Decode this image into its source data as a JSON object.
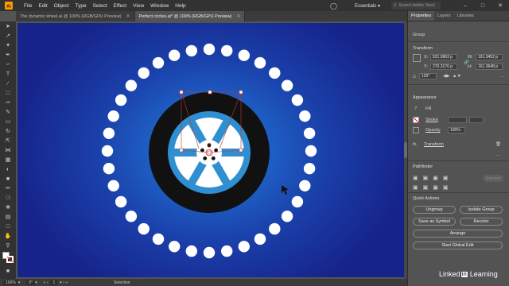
{
  "menubar": {
    "app": "Ai",
    "items": [
      "File",
      "Edit",
      "Object",
      "Type",
      "Select",
      "Effect",
      "View",
      "Window",
      "Help"
    ],
    "workspace": "Essentials",
    "search_placeholder": "Search Adobe Stock"
  },
  "tabs": [
    {
      "label": "The dynamic wheel.ai @ 100% (RGB/GPU Preview)"
    },
    {
      "label": "Perfect circles.ai* @ 100% (RGB/GPU Preview)"
    }
  ],
  "status": {
    "zoom": "100%",
    "angle": "0°",
    "page": "1",
    "mode": "Selection"
  },
  "panel": {
    "tabs": [
      "Properties",
      "Layers",
      "Libraries"
    ],
    "group_label": "Group",
    "transform_title": "Transform",
    "x_label": "X:",
    "x_value": "521.9963 p",
    "y_label": "Y:",
    "y_value": "270.3176 p",
    "w_label": "W:",
    "w_value": "161.3452 p",
    "h_label": "H:",
    "h_value": "161.3648 p",
    "rotate_value": "120°",
    "appearance_title": "Appearance",
    "fill_label": "Fill",
    "stroke_label": "Stroke",
    "opacity_label": "Opacity",
    "opacity_value": "100%",
    "fx_label": "Transform",
    "pathfinder_title": "Pathfinder",
    "expand_label": "Expand",
    "quick_actions_title": "Quick Actions",
    "btn_ungroup": "Ungroup",
    "btn_isolate": "Isolate Group",
    "btn_symbol": "Save as Symbol",
    "btn_recolor": "Recolor",
    "btn_arrange": "Arrange",
    "btn_global_edit": "Start Global Edit"
  },
  "watermark": {
    "left": "Linked",
    "box": "in",
    "right": "Learning"
  },
  "colors": {
    "tire": "#111111",
    "rim": "#2f8fd0",
    "dots": "#ffffff",
    "selection": "#c9342e"
  }
}
